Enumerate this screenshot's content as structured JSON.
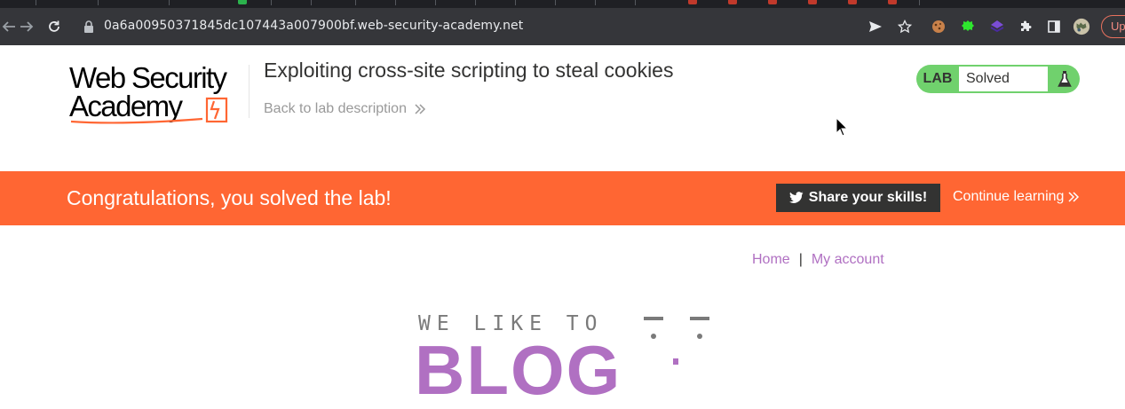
{
  "browser": {
    "url": "0a6a00950371845dc107443a007900bf.web-security-academy.net",
    "update_label": "Up"
  },
  "header": {
    "logo_line1": "Web Security",
    "logo_line2": "Academy",
    "lab_title": "Exploiting cross-site scripting to steal cookies",
    "back_link": "Back to lab description",
    "lab_tag": "LAB",
    "lab_status": "Solved"
  },
  "banner": {
    "message": "Congratulations, you solved the lab!",
    "share_label": "Share your skills!",
    "continue_label": "Continue learning"
  },
  "blog_nav": {
    "home": "Home",
    "separator": "|",
    "account": "My account"
  },
  "hero": {
    "tagline": "WE LIKE TO",
    "word": "BLOG"
  },
  "colors": {
    "accent_orange": "#ff6633",
    "solved_green": "#70d16d",
    "link_purple": "#b070c2"
  }
}
